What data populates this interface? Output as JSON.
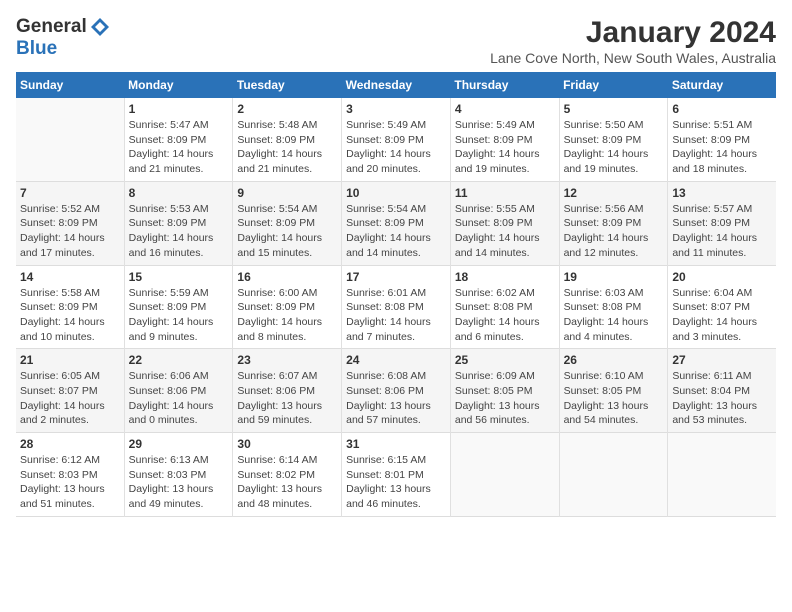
{
  "logo": {
    "general": "General",
    "blue": "Blue"
  },
  "header": {
    "title": "January 2024",
    "subtitle": "Lane Cove North, New South Wales, Australia"
  },
  "weekdays": [
    "Sunday",
    "Monday",
    "Tuesday",
    "Wednesday",
    "Thursday",
    "Friday",
    "Saturday"
  ],
  "weeks": [
    [
      {
        "day": "",
        "info": ""
      },
      {
        "day": "1",
        "info": "Sunrise: 5:47 AM\nSunset: 8:09 PM\nDaylight: 14 hours\nand 21 minutes."
      },
      {
        "day": "2",
        "info": "Sunrise: 5:48 AM\nSunset: 8:09 PM\nDaylight: 14 hours\nand 21 minutes."
      },
      {
        "day": "3",
        "info": "Sunrise: 5:49 AM\nSunset: 8:09 PM\nDaylight: 14 hours\nand 20 minutes."
      },
      {
        "day": "4",
        "info": "Sunrise: 5:49 AM\nSunset: 8:09 PM\nDaylight: 14 hours\nand 19 minutes."
      },
      {
        "day": "5",
        "info": "Sunrise: 5:50 AM\nSunset: 8:09 PM\nDaylight: 14 hours\nand 19 minutes."
      },
      {
        "day": "6",
        "info": "Sunrise: 5:51 AM\nSunset: 8:09 PM\nDaylight: 14 hours\nand 18 minutes."
      }
    ],
    [
      {
        "day": "7",
        "info": "Sunrise: 5:52 AM\nSunset: 8:09 PM\nDaylight: 14 hours\nand 17 minutes."
      },
      {
        "day": "8",
        "info": "Sunrise: 5:53 AM\nSunset: 8:09 PM\nDaylight: 14 hours\nand 16 minutes."
      },
      {
        "day": "9",
        "info": "Sunrise: 5:54 AM\nSunset: 8:09 PM\nDaylight: 14 hours\nand 15 minutes."
      },
      {
        "day": "10",
        "info": "Sunrise: 5:54 AM\nSunset: 8:09 PM\nDaylight: 14 hours\nand 14 minutes."
      },
      {
        "day": "11",
        "info": "Sunrise: 5:55 AM\nSunset: 8:09 PM\nDaylight: 14 hours\nand 14 minutes."
      },
      {
        "day": "12",
        "info": "Sunrise: 5:56 AM\nSunset: 8:09 PM\nDaylight: 14 hours\nand 12 minutes."
      },
      {
        "day": "13",
        "info": "Sunrise: 5:57 AM\nSunset: 8:09 PM\nDaylight: 14 hours\nand 11 minutes."
      }
    ],
    [
      {
        "day": "14",
        "info": "Sunrise: 5:58 AM\nSunset: 8:09 PM\nDaylight: 14 hours\nand 10 minutes."
      },
      {
        "day": "15",
        "info": "Sunrise: 5:59 AM\nSunset: 8:09 PM\nDaylight: 14 hours\nand 9 minutes."
      },
      {
        "day": "16",
        "info": "Sunrise: 6:00 AM\nSunset: 8:09 PM\nDaylight: 14 hours\nand 8 minutes."
      },
      {
        "day": "17",
        "info": "Sunrise: 6:01 AM\nSunset: 8:08 PM\nDaylight: 14 hours\nand 7 minutes."
      },
      {
        "day": "18",
        "info": "Sunrise: 6:02 AM\nSunset: 8:08 PM\nDaylight: 14 hours\nand 6 minutes."
      },
      {
        "day": "19",
        "info": "Sunrise: 6:03 AM\nSunset: 8:08 PM\nDaylight: 14 hours\nand 4 minutes."
      },
      {
        "day": "20",
        "info": "Sunrise: 6:04 AM\nSunset: 8:07 PM\nDaylight: 14 hours\nand 3 minutes."
      }
    ],
    [
      {
        "day": "21",
        "info": "Sunrise: 6:05 AM\nSunset: 8:07 PM\nDaylight: 14 hours\nand 2 minutes."
      },
      {
        "day": "22",
        "info": "Sunrise: 6:06 AM\nSunset: 8:06 PM\nDaylight: 14 hours\nand 0 minutes."
      },
      {
        "day": "23",
        "info": "Sunrise: 6:07 AM\nSunset: 8:06 PM\nDaylight: 13 hours\nand 59 minutes."
      },
      {
        "day": "24",
        "info": "Sunrise: 6:08 AM\nSunset: 8:06 PM\nDaylight: 13 hours\nand 57 minutes."
      },
      {
        "day": "25",
        "info": "Sunrise: 6:09 AM\nSunset: 8:05 PM\nDaylight: 13 hours\nand 56 minutes."
      },
      {
        "day": "26",
        "info": "Sunrise: 6:10 AM\nSunset: 8:05 PM\nDaylight: 13 hours\nand 54 minutes."
      },
      {
        "day": "27",
        "info": "Sunrise: 6:11 AM\nSunset: 8:04 PM\nDaylight: 13 hours\nand 53 minutes."
      }
    ],
    [
      {
        "day": "28",
        "info": "Sunrise: 6:12 AM\nSunset: 8:03 PM\nDaylight: 13 hours\nand 51 minutes."
      },
      {
        "day": "29",
        "info": "Sunrise: 6:13 AM\nSunset: 8:03 PM\nDaylight: 13 hours\nand 49 minutes."
      },
      {
        "day": "30",
        "info": "Sunrise: 6:14 AM\nSunset: 8:02 PM\nDaylight: 13 hours\nand 48 minutes."
      },
      {
        "day": "31",
        "info": "Sunrise: 6:15 AM\nSunset: 8:01 PM\nDaylight: 13 hours\nand 46 minutes."
      },
      {
        "day": "",
        "info": ""
      },
      {
        "day": "",
        "info": ""
      },
      {
        "day": "",
        "info": ""
      }
    ]
  ]
}
